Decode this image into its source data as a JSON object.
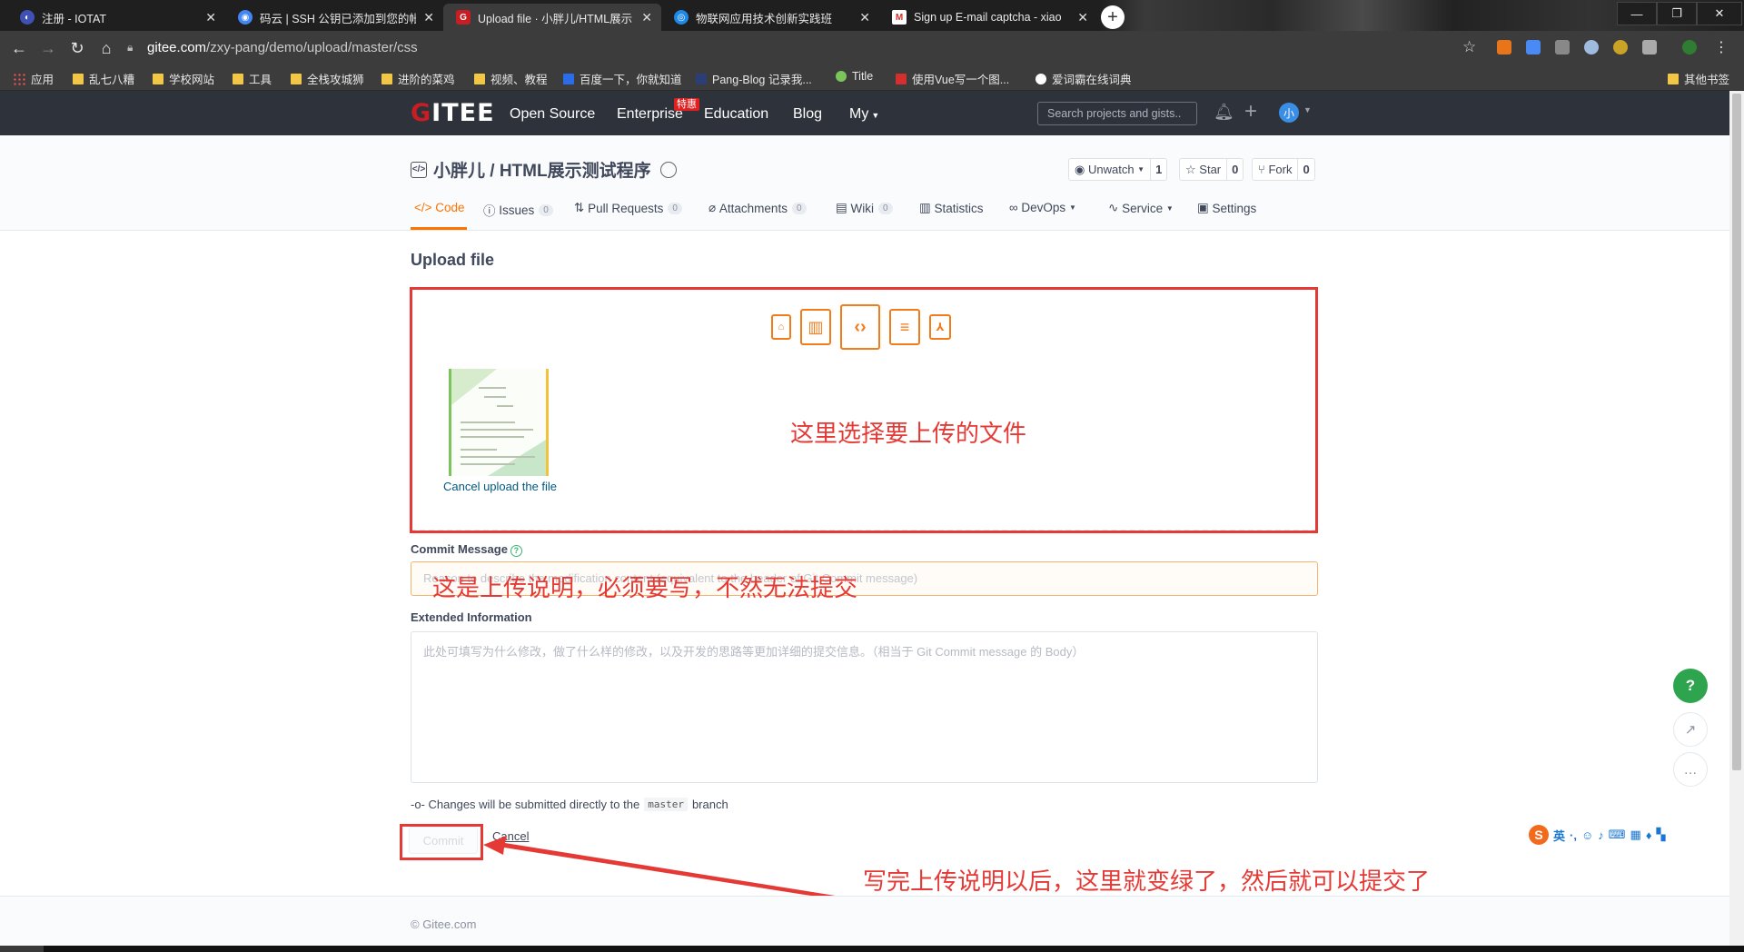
{
  "browser": {
    "tabs": [
      {
        "label": "注册 - IOTAT",
        "icon_color": "#3f51b5"
      },
      {
        "label": "码云 | SSH 公钥已添加到您的帐",
        "icon_color": "#4285f4"
      },
      {
        "label": "Upload file · 小胖儿/HTML展示",
        "icon_color": "#c71d23"
      },
      {
        "label": "物联网应用技术创新实践班",
        "icon_color": "#1e88e5"
      },
      {
        "label": "Sign up E-mail captcha - xiao",
        "icon_color": "#d93025"
      }
    ],
    "url_domain": "gitee.com",
    "url_path": "/zxy-pang/demo/upload/master/css",
    "bookmarks": [
      "应用",
      "乱七八糟",
      "学校网站",
      "工具",
      "全栈攻城狮",
      "进阶的菜鸡",
      "视频、教程",
      "百度一下，你就知道",
      "Pang-Blog 记录我...",
      "Title",
      "使用Vue写一个图...",
      "爱词霸在线词典"
    ],
    "other_bookmarks": "其他书签"
  },
  "header": {
    "logo": "GITEE",
    "nav": [
      "Open Source",
      "Enterprise",
      "Education",
      "Blog",
      "My"
    ],
    "hot_badge": "特惠",
    "search_placeholder": "Search projects and gists..",
    "avatar": "小"
  },
  "project": {
    "title": "小胖儿 / HTML展示测试程序",
    "unwatch": {
      "label": "Unwatch",
      "count": "1"
    },
    "star": {
      "label": "Star",
      "count": "0"
    },
    "fork": {
      "label": "Fork",
      "count": "0"
    },
    "tabs": [
      {
        "label": "Code",
        "count": null
      },
      {
        "label": "Issues",
        "count": "0"
      },
      {
        "label": "Pull Requests",
        "count": "0"
      },
      {
        "label": "Attachments",
        "count": "0"
      },
      {
        "label": "Wiki",
        "count": "0"
      },
      {
        "label": "Statistics",
        "count": null
      },
      {
        "label": "DevOps",
        "count": null
      },
      {
        "label": "Service",
        "count": null
      },
      {
        "label": "Settings",
        "count": null
      }
    ]
  },
  "upload": {
    "heading": "Upload file",
    "cancel_upload": "Cancel upload the file",
    "commit_label": "Commit Message",
    "commit_placeholder": "Reason to describe the modification content (equivalent to the header of Git Commit message)",
    "extended_label": "Extended Information",
    "extended_placeholder": "此处可填写为什么修改，做了什么样的修改，以及开发的思路等更加详细的提交信息。（相当于 Git Commit message 的 Body）",
    "notice_before": "Changes will be submitted directly to the",
    "branch": "master",
    "notice_after": "branch",
    "commit_button": "Commit",
    "cancel_button": "Cancel"
  },
  "annotations": {
    "select_file": "这里选择要上传的文件",
    "commit_desc": "这是上传说明，必须要写，不然无法提交",
    "commit_hint": "写完上传说明以后，这里就变绿了，然后就可以提交了",
    "color": "#e53935"
  },
  "footer": {
    "copyright": "© Gitee.com"
  },
  "ime": {
    "mode": "英"
  },
  "colors": {
    "brand_red": "#c71d23",
    "accent_orange": "#fe7300",
    "help_green": "#2ea44f"
  }
}
